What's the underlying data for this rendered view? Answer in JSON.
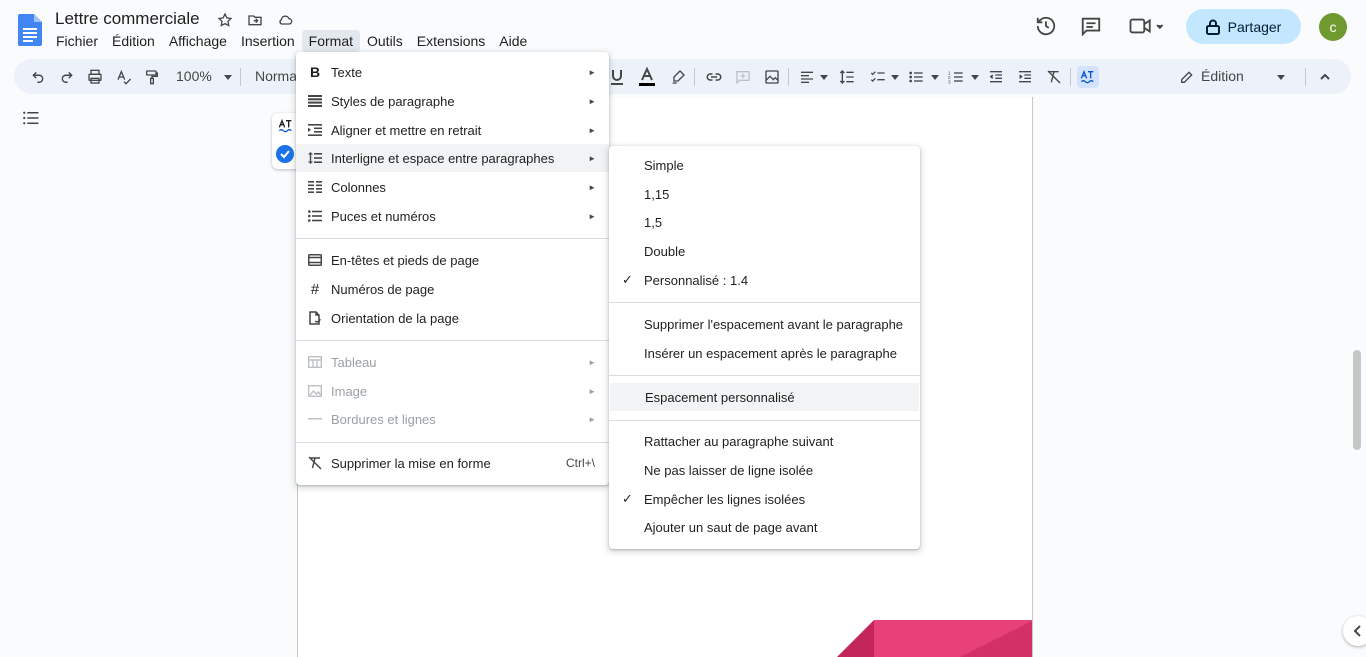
{
  "header": {
    "title": "Lettre commerciale",
    "menu": [
      "Fichier",
      "Édition",
      "Affichage",
      "Insertion",
      "Format",
      "Outils",
      "Extensions",
      "Aide"
    ],
    "active_menu": "Format",
    "share_label": "Partager",
    "avatar_letter": "c"
  },
  "toolbar": {
    "zoom": "100%",
    "style": "Normal",
    "mode": "Édition"
  },
  "format_menu": {
    "items": [
      {
        "icon": "bold-icon",
        "label": "Texte",
        "submenu": true
      },
      {
        "icon": "paragraph-styles-icon",
        "label": "Styles de paragraphe",
        "submenu": true
      },
      {
        "icon": "indent-icon",
        "label": "Aligner et mettre en retrait",
        "submenu": true
      },
      {
        "icon": "line-spacing-icon",
        "label": "Interligne et espace entre paragraphes",
        "submenu": true,
        "active": true
      },
      {
        "icon": "columns-icon",
        "label": "Colonnes",
        "submenu": true
      },
      {
        "icon": "bullets-icon",
        "label": "Puces et numéros",
        "submenu": true
      },
      {
        "icon": "header-footer-icon",
        "label": "En-têtes et pieds de page"
      },
      {
        "icon": "hash-icon",
        "label": "Numéros de page"
      },
      {
        "icon": "orientation-icon",
        "label": "Orientation de la page"
      },
      {
        "icon": "table-icon",
        "label": "Tableau",
        "submenu": true,
        "disabled": true
      },
      {
        "icon": "image-icon",
        "label": "Image",
        "submenu": true,
        "disabled": true
      },
      {
        "icon": "borders-icon",
        "label": "Bordures et lignes",
        "submenu": true,
        "disabled": true
      },
      {
        "icon": "clear-format-icon",
        "label": "Supprimer la mise en forme",
        "shortcut": "Ctrl+\\"
      }
    ]
  },
  "spacing_submenu": {
    "items": [
      {
        "label": "Simple"
      },
      {
        "label": "1,15"
      },
      {
        "label": "1,5"
      },
      {
        "label": "Double"
      },
      {
        "label": "Personnalisé : 1.4",
        "checked": true
      },
      {
        "label": "Supprimer l'espacement avant le paragraphe"
      },
      {
        "label": "Insérer un espacement après le paragraphe"
      },
      {
        "label": "Espacement personnalisé",
        "hover": true
      },
      {
        "label": "Rattacher au paragraphe suivant"
      },
      {
        "label": "Ne pas laisser de ligne isolée"
      },
      {
        "label": "Empêcher les lignes isolées",
        "checked": true
      },
      {
        "label": "Ajouter un saut de page avant"
      }
    ]
  }
}
